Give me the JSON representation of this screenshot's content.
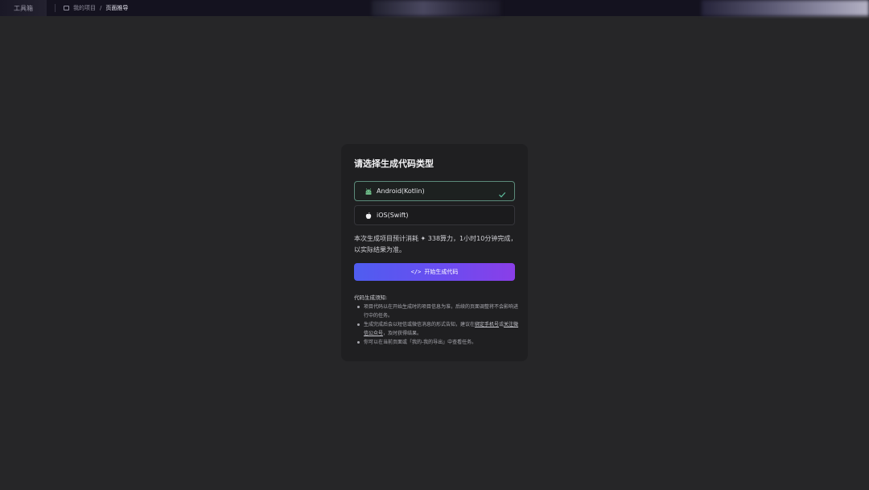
{
  "topbar": {
    "logo_text": "工具箱",
    "breadcrumb": {
      "parent": "我的项目",
      "separator": "/",
      "current": "页面推导"
    }
  },
  "dialog": {
    "title": "请选择生成代码类型",
    "options": [
      {
        "label": "Android(Kotlin)",
        "icon": "android-icon",
        "selected": true
      },
      {
        "label": "iOS(Swift)",
        "icon": "apple-icon",
        "selected": false
      }
    ],
    "estimate_text": "本次生成项目预计消耗 ✦ 338算力，1小时10分钟完成，以实际结果为准。",
    "start_button": {
      "label": "开始生成代码",
      "icon": "code-icon"
    },
    "notes": {
      "title": "代码生成须知:",
      "items": [
        {
          "text": "项目代码以在开始生成时的项目信息为准，后续的页面调整将不会影响进行中的任务。"
        },
        {
          "pre": "生成完成后会以短信或微信消息的形式告知，建议在",
          "link1": "绑定手机号",
          "mid": "或",
          "link2": "关注微信公众号",
          "post": "，及时获得结果。"
        },
        {
          "text": "你可以在当前页面或「我的-我的导出」中查看任务。"
        }
      ]
    }
  },
  "colors": {
    "background": "#262628",
    "card": "#1f1f21",
    "selected_border": "#5b8a7a",
    "check": "#5fbf9f",
    "android_green": "#6fbf8a",
    "button_gradient_start": "#4f5df0",
    "button_gradient_end": "#8a3ee8"
  }
}
